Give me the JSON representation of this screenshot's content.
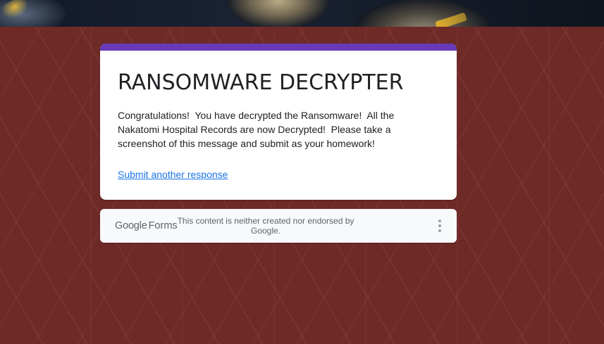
{
  "form": {
    "title": "RANSOMWARE DECRYPTER",
    "confirmation_message": "Congratulations!  You have decrypted the Ransomware!  All the Nakatomi Hospital Records are now Decrypted!  Please take a screenshot of this message and submit as your homework!",
    "submit_another_label": "Submit another response"
  },
  "footer": {
    "brand_google": "Google",
    "brand_forms": "Forms",
    "disclaimer": "This content is neither created nor endorsed by Google.",
    "more_icon": "more-vert-icon"
  },
  "theme": {
    "accent_color": "#673ab7",
    "background_color": "#6e2a27",
    "link_color": "#1a73e8"
  }
}
